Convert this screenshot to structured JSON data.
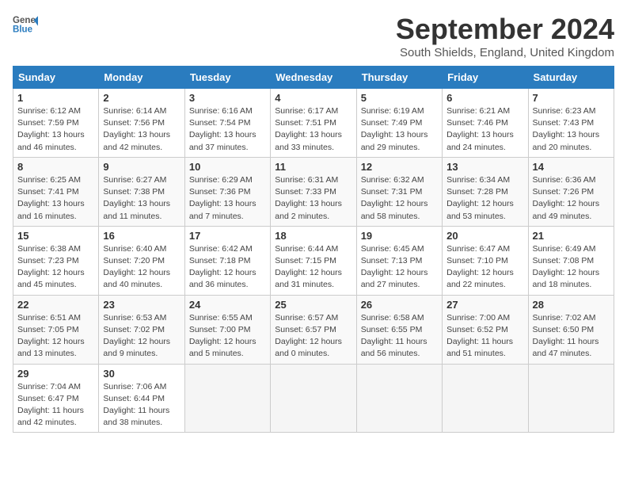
{
  "header": {
    "logo_line1": "General",
    "logo_line2": "Blue",
    "month": "September 2024",
    "location": "South Shields, England, United Kingdom"
  },
  "weekdays": [
    "Sunday",
    "Monday",
    "Tuesday",
    "Wednesday",
    "Thursday",
    "Friday",
    "Saturday"
  ],
  "weeks": [
    [
      {
        "day": "1",
        "info": "Sunrise: 6:12 AM\nSunset: 7:59 PM\nDaylight: 13 hours\nand 46 minutes."
      },
      {
        "day": "2",
        "info": "Sunrise: 6:14 AM\nSunset: 7:56 PM\nDaylight: 13 hours\nand 42 minutes."
      },
      {
        "day": "3",
        "info": "Sunrise: 6:16 AM\nSunset: 7:54 PM\nDaylight: 13 hours\nand 37 minutes."
      },
      {
        "day": "4",
        "info": "Sunrise: 6:17 AM\nSunset: 7:51 PM\nDaylight: 13 hours\nand 33 minutes."
      },
      {
        "day": "5",
        "info": "Sunrise: 6:19 AM\nSunset: 7:49 PM\nDaylight: 13 hours\nand 29 minutes."
      },
      {
        "day": "6",
        "info": "Sunrise: 6:21 AM\nSunset: 7:46 PM\nDaylight: 13 hours\nand 24 minutes."
      },
      {
        "day": "7",
        "info": "Sunrise: 6:23 AM\nSunset: 7:43 PM\nDaylight: 13 hours\nand 20 minutes."
      }
    ],
    [
      {
        "day": "8",
        "info": "Sunrise: 6:25 AM\nSunset: 7:41 PM\nDaylight: 13 hours\nand 16 minutes."
      },
      {
        "day": "9",
        "info": "Sunrise: 6:27 AM\nSunset: 7:38 PM\nDaylight: 13 hours\nand 11 minutes."
      },
      {
        "day": "10",
        "info": "Sunrise: 6:29 AM\nSunset: 7:36 PM\nDaylight: 13 hours\nand 7 minutes."
      },
      {
        "day": "11",
        "info": "Sunrise: 6:31 AM\nSunset: 7:33 PM\nDaylight: 13 hours\nand 2 minutes."
      },
      {
        "day": "12",
        "info": "Sunrise: 6:32 AM\nSunset: 7:31 PM\nDaylight: 12 hours\nand 58 minutes."
      },
      {
        "day": "13",
        "info": "Sunrise: 6:34 AM\nSunset: 7:28 PM\nDaylight: 12 hours\nand 53 minutes."
      },
      {
        "day": "14",
        "info": "Sunrise: 6:36 AM\nSunset: 7:26 PM\nDaylight: 12 hours\nand 49 minutes."
      }
    ],
    [
      {
        "day": "15",
        "info": "Sunrise: 6:38 AM\nSunset: 7:23 PM\nDaylight: 12 hours\nand 45 minutes."
      },
      {
        "day": "16",
        "info": "Sunrise: 6:40 AM\nSunset: 7:20 PM\nDaylight: 12 hours\nand 40 minutes."
      },
      {
        "day": "17",
        "info": "Sunrise: 6:42 AM\nSunset: 7:18 PM\nDaylight: 12 hours\nand 36 minutes."
      },
      {
        "day": "18",
        "info": "Sunrise: 6:44 AM\nSunset: 7:15 PM\nDaylight: 12 hours\nand 31 minutes."
      },
      {
        "day": "19",
        "info": "Sunrise: 6:45 AM\nSunset: 7:13 PM\nDaylight: 12 hours\nand 27 minutes."
      },
      {
        "day": "20",
        "info": "Sunrise: 6:47 AM\nSunset: 7:10 PM\nDaylight: 12 hours\nand 22 minutes."
      },
      {
        "day": "21",
        "info": "Sunrise: 6:49 AM\nSunset: 7:08 PM\nDaylight: 12 hours\nand 18 minutes."
      }
    ],
    [
      {
        "day": "22",
        "info": "Sunrise: 6:51 AM\nSunset: 7:05 PM\nDaylight: 12 hours\nand 13 minutes."
      },
      {
        "day": "23",
        "info": "Sunrise: 6:53 AM\nSunset: 7:02 PM\nDaylight: 12 hours\nand 9 minutes."
      },
      {
        "day": "24",
        "info": "Sunrise: 6:55 AM\nSunset: 7:00 PM\nDaylight: 12 hours\nand 5 minutes."
      },
      {
        "day": "25",
        "info": "Sunrise: 6:57 AM\nSunset: 6:57 PM\nDaylight: 12 hours\nand 0 minutes."
      },
      {
        "day": "26",
        "info": "Sunrise: 6:58 AM\nSunset: 6:55 PM\nDaylight: 11 hours\nand 56 minutes."
      },
      {
        "day": "27",
        "info": "Sunrise: 7:00 AM\nSunset: 6:52 PM\nDaylight: 11 hours\nand 51 minutes."
      },
      {
        "day": "28",
        "info": "Sunrise: 7:02 AM\nSunset: 6:50 PM\nDaylight: 11 hours\nand 47 minutes."
      }
    ],
    [
      {
        "day": "29",
        "info": "Sunrise: 7:04 AM\nSunset: 6:47 PM\nDaylight: 11 hours\nand 42 minutes."
      },
      {
        "day": "30",
        "info": "Sunrise: 7:06 AM\nSunset: 6:44 PM\nDaylight: 11 hours\nand 38 minutes."
      },
      {
        "day": "",
        "info": ""
      },
      {
        "day": "",
        "info": ""
      },
      {
        "day": "",
        "info": ""
      },
      {
        "day": "",
        "info": ""
      },
      {
        "day": "",
        "info": ""
      }
    ]
  ]
}
